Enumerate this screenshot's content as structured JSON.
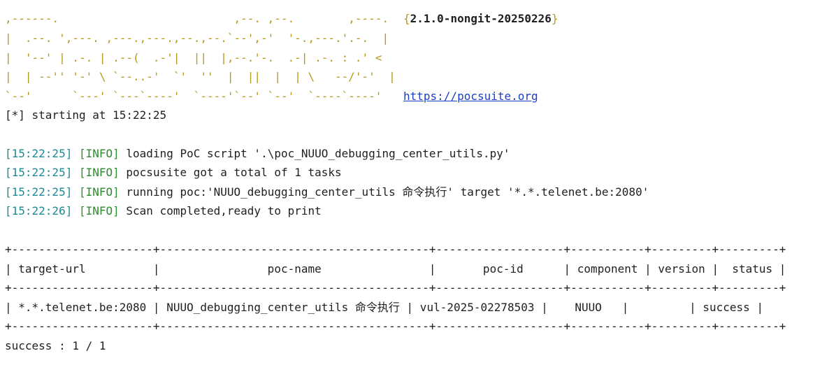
{
  "banner": {
    "lines": [
      ",------.                          ,--. ,--.        ,----.",
      "|  .--. ',---. ,---.,---.,--.,--.`--',-'  '-.,---.'.-.  |",
      "|  '--' | .-. | .--(  .-'|  ||  |,--.'-.  .-| .-. : .' <",
      "|  | --'' '-' \\ `--..-'  `'  ''  |  ||  |  | \\   --/'-'  |",
      "`--'      `---' `---`----'  `----'`--' `--'  `----`----'"
    ],
    "version": "2.1.0-nongit-20250226",
    "brace_open": "{",
    "brace_close": "}",
    "url": "https://pocsuite.org"
  },
  "start_line": "[*] starting at 15:22:25",
  "logs": [
    {
      "ts": "[15:22:25]",
      "level": "[INFO]",
      "msg": "loading PoC script '.\\poc_NUUO_debugging_center_utils.py'"
    },
    {
      "ts": "[15:22:25]",
      "level": "[INFO]",
      "msg": "pocsusite got a total of 1 tasks"
    },
    {
      "ts": "[15:22:25]",
      "level": "[INFO]",
      "msg": "running poc:'NUUO_debugging_center_utils 命令执行' target '*.*.telenet.be:2080'"
    },
    {
      "ts": "[15:22:26]",
      "level": "[INFO]",
      "msg": "Scan completed,ready to print"
    }
  ],
  "table": {
    "border": "+---------------------+----------------------------------------+-------------------+-----------+---------+---------+",
    "header": "| target-url          |                poc-name                |       poc-id      | component | version |  status |",
    "row": "| *.*.telenet.be:2080 | NUUO_debugging_center_utils 命令执行 | vul-2025-02278503 |    NUUO   |         | success |"
  },
  "summary": "success : 1 / 1",
  "colors": {
    "banner": "#b59a1c",
    "timestamp": "#1a8a94",
    "level": "#2e8b2e",
    "link": "#1a3fc7",
    "text": "#1f1f1f"
  }
}
